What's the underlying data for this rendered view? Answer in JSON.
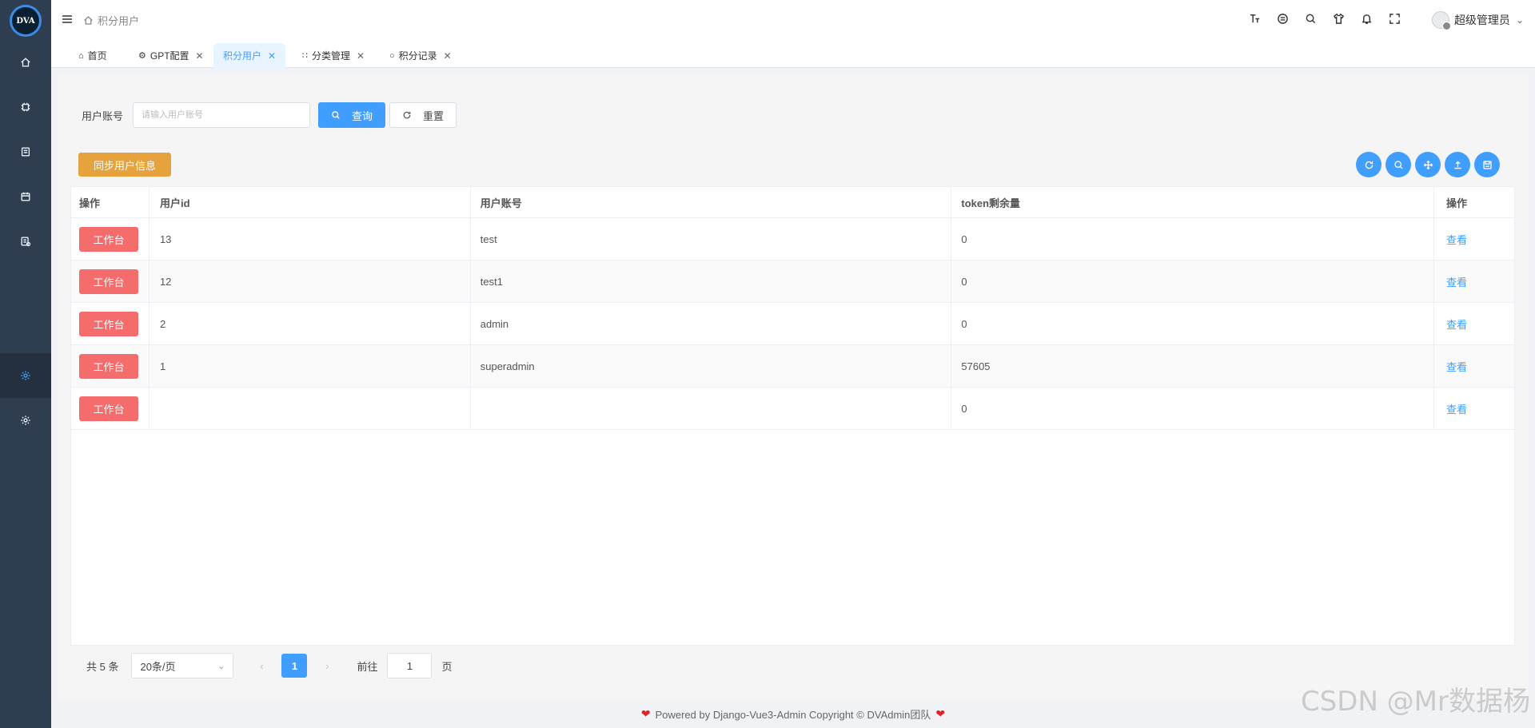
{
  "app": {
    "logo_text": "DVA"
  },
  "header": {
    "breadcrumb": "积分用户",
    "user_name": "超级管理员"
  },
  "tabs": [
    {
      "label": "首页",
      "icon": "home-icon"
    },
    {
      "label": "GPT配置",
      "icon": "gear-icon"
    },
    {
      "label": "积分用户",
      "icon": "",
      "active": true
    },
    {
      "label": "分类管理",
      "icon": "grid-icon"
    },
    {
      "label": "积分记录",
      "icon": "clock-icon"
    }
  ],
  "search": {
    "label": "用户账号",
    "placeholder": "请输入用户账号",
    "query_label": "查询",
    "reset_label": "重置"
  },
  "actions": {
    "sync_label": "同步用户信息"
  },
  "table": {
    "headers": [
      "操作",
      "用户id",
      "用户账号",
      "token剩余量",
      "操作"
    ],
    "action_label": "工作台",
    "view_label": "查看",
    "rows": [
      {
        "id": "13",
        "account": "test",
        "token": "0"
      },
      {
        "id": "12",
        "account": "test1",
        "token": "0"
      },
      {
        "id": "2",
        "account": "admin",
        "token": "0"
      },
      {
        "id": "1",
        "account": "superadmin",
        "token": "57605"
      },
      {
        "id": "",
        "account": "",
        "token": "0"
      }
    ]
  },
  "pagination": {
    "total_text": "共 5 条",
    "page_size": "20条/页",
    "current_page": "1",
    "goto_label": "前往",
    "goto_value": "1",
    "page_suffix": "页"
  },
  "footer": {
    "text": "Powered by Django-Vue3-Admin Copyright © DVAdmin团队"
  },
  "watermark": "CSDN @Mr数据杨",
  "colors": {
    "primary": "#409eff",
    "danger": "#f56c6c",
    "warning": "#e6a23c",
    "sidebar": "#2f3d50"
  }
}
